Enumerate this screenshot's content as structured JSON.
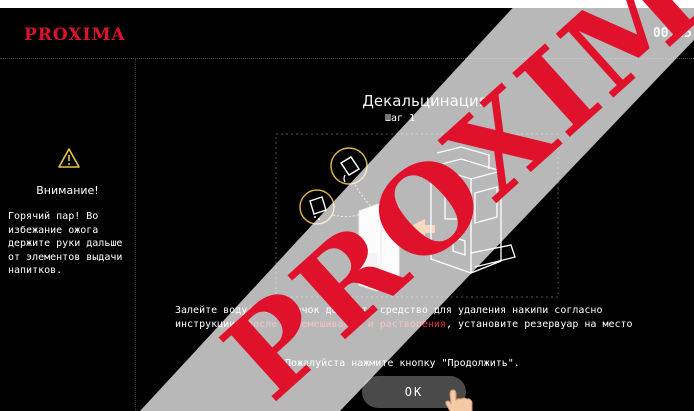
{
  "app": {
    "logo": "PROXIMA",
    "time": "00:45"
  },
  "warning": {
    "title": "Внимание!",
    "text": "Горячий пар! Во избежание ожога держите руки дальше от элементов выдачи напитков."
  },
  "main": {
    "title": "Декальцинация",
    "step": "Шаг 1",
    "instruction": {
      "part1": "Залейте воду",
      "highlight1": "(1 л)",
      "part2": "в бачок добавьте средство для удаления накипи согласно инструкции, ",
      "highlight2": "после перемешивания и растворения",
      "part3": ", установите резервуар на место"
    },
    "prompt": "Пожалуйста нажмите кнопку \"Продолжить\".",
    "ok_label": "OK"
  },
  "watermark": {
    "text": "PROXIMA",
    "color": "#e0112b"
  },
  "colors": {
    "accent": "#e0112b",
    "background": "#000000",
    "text": "#ffffff"
  },
  "icons": [
    "warning-icon",
    "coffee-machine-icon",
    "water-tank-icon",
    "pour-icon",
    "powder-icon",
    "hand-pointer-icon"
  ]
}
